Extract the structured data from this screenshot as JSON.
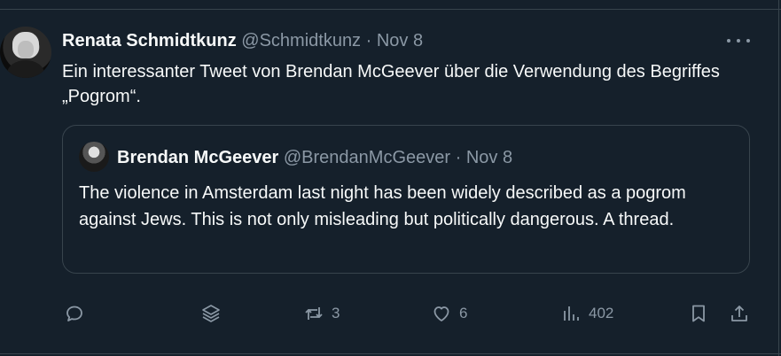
{
  "tweet": {
    "author_name": "Renata Schmidtkunz",
    "author_handle": "@Schmidtkunz",
    "separator": "·",
    "date": "Nov 8",
    "text": "Ein interessanter Tweet von Brendan McGeever über die Verwendung des Begriffes „Pogrom“."
  },
  "quoted_tweet": {
    "author_name": "Brendan McGeever",
    "author_handle": "@BrendanMcGeever",
    "separator": "·",
    "date": "Nov 8",
    "text": "The violence in Amsterdam last night has been widely described as a pogrom against Jews. This is not only misleading but politically dangerous. A thread."
  },
  "actions": {
    "reply_icon": "reply-icon",
    "grok_icon": "layers-icon",
    "retweet_icon": "retweet-icon",
    "retweet_count": "3",
    "like_icon": "heart-icon",
    "like_count": "6",
    "views_icon": "views-icon",
    "views_count": "402",
    "bookmark_icon": "bookmark-icon",
    "share_icon": "share-icon"
  },
  "colors": {
    "background": "#15202b",
    "text": "#f7f9f9",
    "muted": "#8b98a5",
    "border": "#38444d"
  }
}
